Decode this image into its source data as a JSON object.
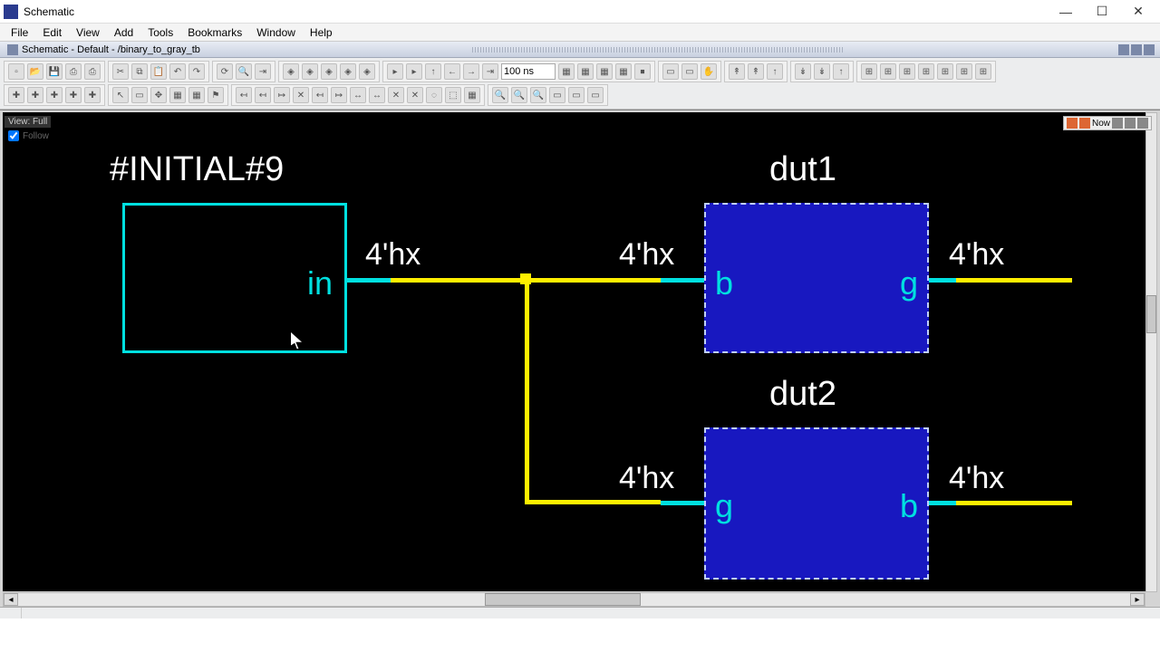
{
  "window": {
    "title": "Schematic",
    "minimize": "—",
    "maximize": "☐",
    "close": "✕"
  },
  "menu": {
    "file": "File",
    "edit": "Edit",
    "view": "View",
    "add": "Add",
    "tools": "Tools",
    "bookmarks": "Bookmarks",
    "window": "Window",
    "help": "Help"
  },
  "document": {
    "path": "Schematic - Default - /binary_to_gray_tb"
  },
  "toolbar": {
    "time_field": "100 ns"
  },
  "overlay": {
    "view_tag": "View: Full",
    "follow_label": "Follow",
    "now_label": "Now"
  },
  "schematic": {
    "blocks": {
      "initial": {
        "label": "#INITIAL#9",
        "port_out": "in"
      },
      "dut1": {
        "label": "dut1",
        "port_in": "b",
        "port_out": "g"
      },
      "dut2": {
        "label": "dut2",
        "port_in": "g",
        "port_out": "b"
      }
    },
    "signals": {
      "init_out": "4'hx",
      "dut1_in": "4'hx",
      "dut1_out": "4'hx",
      "dut2_in": "4'hx",
      "dut2_out": "4'hx"
    }
  }
}
